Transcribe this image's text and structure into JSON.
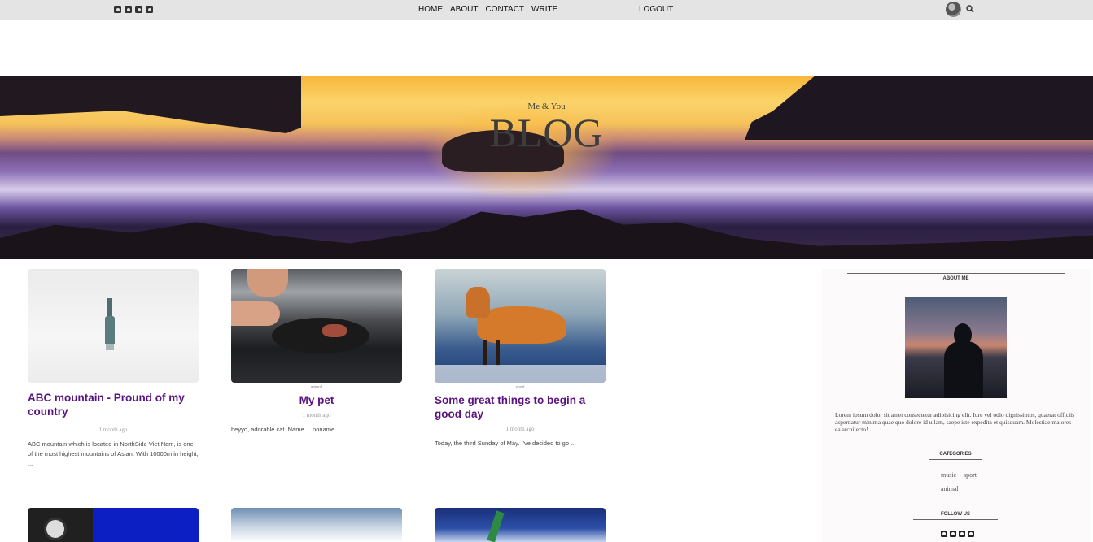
{
  "topbar": {
    "social_icons": [
      "facebook-icon",
      "instagram-icon",
      "pinterest-icon",
      "twitter-icon"
    ],
    "nav": [
      "HOME",
      "ABOUT",
      "CONTACT",
      "WRITE"
    ],
    "logout": "LOGOUT"
  },
  "hero": {
    "subtitle": "Me & You",
    "title": "BLOG"
  },
  "posts": [
    {
      "title": "ABC mountain - Pround of my country",
      "category": "",
      "date": "1 month ago",
      "desc": "ABC mountain which is located in NorthSide Viet Nam, is one of the most highest mountains of Asian. With 10000m in height, ..."
    },
    {
      "title": "My pet",
      "category": "animal",
      "date": "1 month ago",
      "desc": "heyyo, adorable cat. Name ... noname."
    },
    {
      "title": "Some great things to begin a good day",
      "category": "sport",
      "date": "1 month ago",
      "desc": "Today, the third Sunday of May. I've decided to go ..."
    }
  ],
  "sidebar": {
    "about_title": "ABOUT ME",
    "about_text": "Lorem ipsum dolor sit amet consectetur adipisicing elit. Iure vel odio dignissimos, quaerat officiis aspernatur minima quae quo dolore id ullam, saepe iste expedita et quisquam. Molestiae maiores ea architecto!",
    "categories_title": "CATEGORIES",
    "categories": [
      "music",
      "sport",
      "animal"
    ],
    "follow_title": "FOLLOW US"
  },
  "colors": {
    "topbar": "#e4e4e4",
    "post_title": "#5a1282",
    "sidebar_bg": "#fcfafa"
  }
}
